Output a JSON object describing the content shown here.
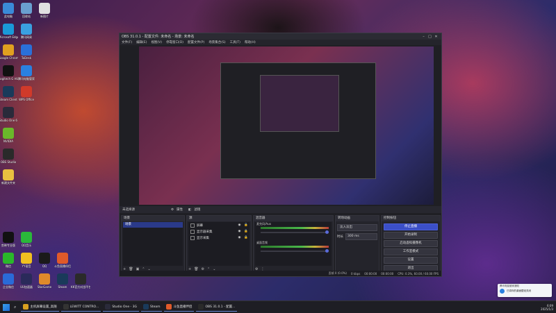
{
  "desktop_icons": [
    {
      "label": "此电脑",
      "color": "#3a8ad8"
    },
    {
      "label": "回收站",
      "color": "#6aa0d0"
    },
    {
      "label": "新图片",
      "color": "#e0e0e0"
    },
    {
      "label": "Microsoft Edge",
      "color": "#1a9ad8"
    },
    {
      "label": "腾讯网易",
      "color": "#3aa0e0"
    },
    {
      "label": "Google Chrome",
      "color": "#e0a020"
    },
    {
      "label": "ToDesk",
      "color": "#2a70d8"
    },
    {
      "label": "Logitech G HUB",
      "color": "#111111"
    },
    {
      "label": "腾讯电脑管家",
      "color": "#2a80e0"
    },
    {
      "label": "Steam Client",
      "color": "#1a3a5a"
    },
    {
      "label": "WPS Office",
      "color": "#d03a2a"
    },
    {
      "label": "Studio One 6",
      "color": "#2a2a3a"
    },
    {
      "label": "NVIDIA",
      "color": "#6ab82a"
    },
    {
      "label": "OBS Studio",
      "color": "#2a2a2a"
    },
    {
      "label": "新建文件夹",
      "color": "#e8c040"
    },
    {
      "label": "剪映专业版",
      "color": "#111111"
    },
    {
      "label": "QQ音乐",
      "color": "#2ab83a"
    },
    {
      "label": "微信",
      "color": "#2ab82a"
    },
    {
      "label": "YY语音",
      "color": "#f0c020"
    },
    {
      "label": "QQ",
      "color": "#1a1a1a"
    },
    {
      "label": "斗鱼直播伴侣",
      "color": "#e05a2a"
    },
    {
      "label": "企业微信",
      "color": "#2a6ad8"
    },
    {
      "label": "UU加速器",
      "color": "#2a2a5a"
    },
    {
      "label": "StarGame",
      "color": "#e08a2a"
    },
    {
      "label": "Steam",
      "color": "#1a3a5a"
    },
    {
      "label": "KK官方对战平台",
      "color": "#2a2a2a"
    }
  ],
  "obs": {
    "title": "OBS 31.0.1 - 配置文件: 未命名 - 场景: 未命名",
    "menu": [
      "文件(F)",
      "编辑(E)",
      "视图(V)",
      "停靠窗口(D)",
      "配置文件(P)",
      "场景集合(S)",
      "工具(T)",
      "帮助(H)"
    ],
    "source_bar": {
      "no_source": "未选择源",
      "properties": "属性",
      "filters": "滤镜"
    },
    "scenes": {
      "title": "场景",
      "items": [
        "场景"
      ]
    },
    "sources": {
      "title": "源",
      "items": [
        "屏幕",
        "显示器采集",
        "显示采集"
      ]
    },
    "mixer": {
      "title": "混音器",
      "channels": [
        {
          "name": "麦克风/Aux"
        },
        {
          "name": "桌面音频"
        }
      ]
    },
    "transitions": {
      "title": "转场动画",
      "type": "淡入淡出",
      "duration_label": "时长",
      "duration": "300 ms"
    },
    "controls": {
      "title": "控制按钮",
      "buttons": [
        "停止直播",
        "开始录制",
        "启动虚拟摄像机",
        "工作室模式",
        "设置",
        "退出"
      ]
    },
    "status": {
      "frames": "丢帧 0 (0.0%)",
      "live": "0 kbps",
      "live_time": "00:00:00",
      "rec_time": "00:00:00",
      "cpu": "CPU: 0.3%, 60.00 / 60.00 FPS"
    }
  },
  "notification": {
    "title": "腾讯电脑管家通知",
    "body": "已将你的桌面壁纸关闭"
  },
  "taskbar": {
    "items": [
      {
        "label": "主机屏幕设置_高随",
        "color": "#d8a020"
      },
      {
        "label": "LEWITT CONTRO...",
        "color": "#333333"
      },
      {
        "label": "Studio One - 3G",
        "color": "#2a2a3a"
      },
      {
        "label": "Steam",
        "color": "#1a3a5a"
      },
      {
        "label": "斗鱼直播伴侣",
        "color": "#e05a2a"
      },
      {
        "label": "OBS 31.0.1 - 配置...",
        "color": "#2a2a2a"
      }
    ],
    "time": "6:09",
    "date": "2025/1/3"
  }
}
